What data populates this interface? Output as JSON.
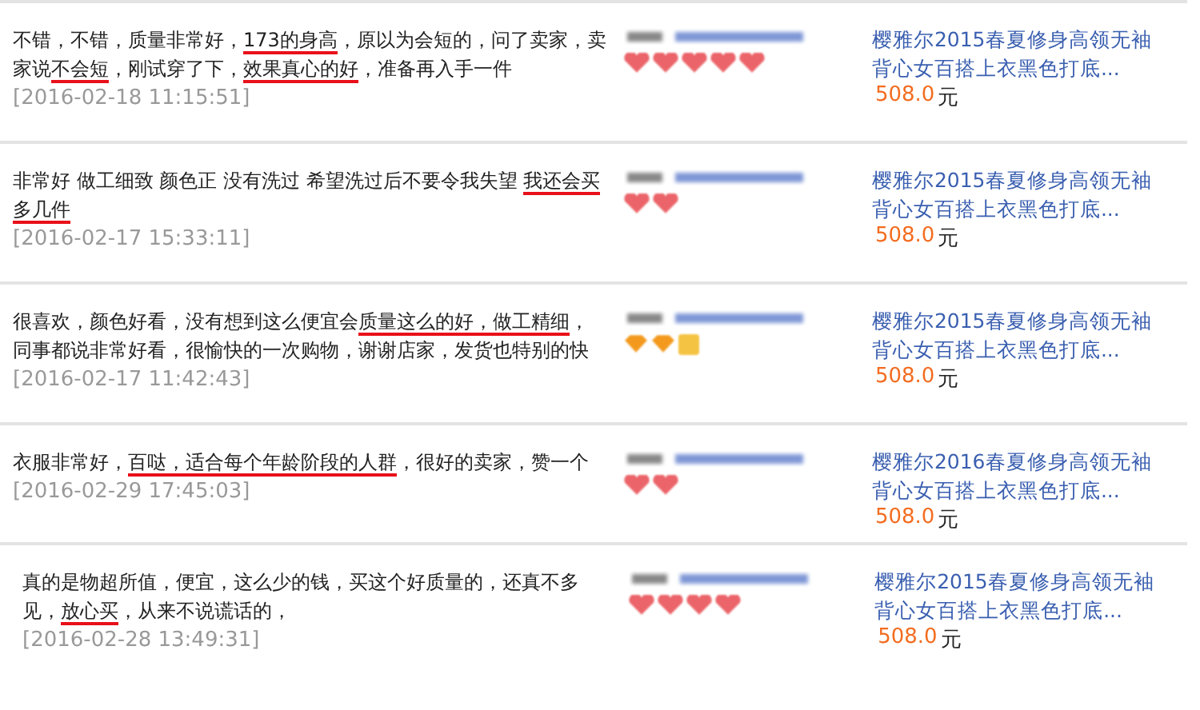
{
  "reviews": [
    {
      "comment": [
        [
          {
            "text": "不错，不错，质量非常好，",
            "underlined": false
          },
          {
            "text": "173的身高",
            "underlined": true
          },
          {
            "text": "，原以为会短的，问了卖家，卖",
            "underlined": false
          }
        ],
        [
          {
            "text": "家说",
            "underlined": false
          },
          {
            "text": "不会短",
            "underlined": true
          },
          {
            "text": "，刚试穿了下，",
            "underlined": false
          },
          {
            "text": "效果真心的好",
            "underlined": true
          },
          {
            "text": "，准备再入手一件",
            "underlined": false
          }
        ]
      ],
      "time": "[2016-02-18 11:15:51]",
      "rank_icons": [
        {
          "kind": "heart"
        },
        {
          "kind": "heart"
        },
        {
          "kind": "heart"
        },
        {
          "kind": "heart"
        },
        {
          "kind": "heart"
        }
      ],
      "product": [
        "樱雅尔2015春夏修身高领无袖",
        "背心女百搭上衣黑色打底..."
      ],
      "price": "508.0",
      "currency": "元"
    },
    {
      "comment": [
        [
          {
            "text": "非常好 做工细致 颜色正 没有洗过 希望洗过后不要令我失望 ",
            "underlined": false
          },
          {
            "text": "我还会买",
            "underlined": true
          }
        ],
        [
          {
            "text": "多几件",
            "underlined": true
          }
        ]
      ],
      "time": "[2016-02-17 15:33:11]",
      "rank_icons": [
        {
          "kind": "heart"
        },
        {
          "kind": "heart"
        }
      ],
      "product": [
        "樱雅尔2015春夏修身高领无袖",
        "背心女百搭上衣黑色打底..."
      ],
      "price": "508.0",
      "currency": "元"
    },
    {
      "comment": [
        [
          {
            "text": "很喜欢，颜色好看，没有想到这么便宜会",
            "underlined": false
          },
          {
            "text": "质量这么的好，做工精细",
            "underlined": true
          },
          {
            "text": "，",
            "underlined": false
          }
        ],
        [
          {
            "text": "同事都说非常好看，很愉快的一次购物，谢谢店家，发货也特别的快",
            "underlined": false
          }
        ]
      ],
      "time": "[2016-02-17 11:42:43]",
      "rank_icons": [
        {
          "kind": "diamond"
        },
        {
          "kind": "diamond"
        },
        {
          "kind": "badge"
        }
      ],
      "product": [
        "樱雅尔2015春夏修身高领无袖",
        "背心女百搭上衣黑色打底..."
      ],
      "price": "508.0",
      "currency": "元"
    },
    {
      "comment": [
        [
          {
            "text": "衣服非常好，",
            "underlined": false
          },
          {
            "text": "百哒，适合每个年龄阶段的人群",
            "underlined": true
          },
          {
            "text": "，很好的卖家，赞一个",
            "underlined": false
          }
        ]
      ],
      "time": "[2016-02-29 17:45:03]",
      "rank_icons": [
        {
          "kind": "heart"
        },
        {
          "kind": "heart"
        }
      ],
      "product": [
        "樱雅尔2016春夏修身高领无袖",
        "背心女百搭上衣黑色打底..."
      ],
      "price": "508.0",
      "currency": "元"
    },
    {
      "comment": [
        [
          {
            "text": "真的是物超所值，便宜，这么少的钱，买这个好质量的，还真不多",
            "underlined": false
          }
        ],
        [
          {
            "text": "见，",
            "underlined": false
          },
          {
            "text": "放心买",
            "underlined": true
          },
          {
            "text": "，从来不说谎话的，",
            "underlined": false
          }
        ]
      ],
      "time": "[2016-02-28 13:49:31]",
      "rank_icons": [
        {
          "kind": "heart"
        },
        {
          "kind": "heart"
        },
        {
          "kind": "heart"
        },
        {
          "kind": "heart"
        }
      ],
      "product": [
        "樱雅尔2015春夏修身高领无袖",
        "背心女百搭上衣黑色打底..."
      ],
      "price": "508.0",
      "currency": "元"
    }
  ]
}
